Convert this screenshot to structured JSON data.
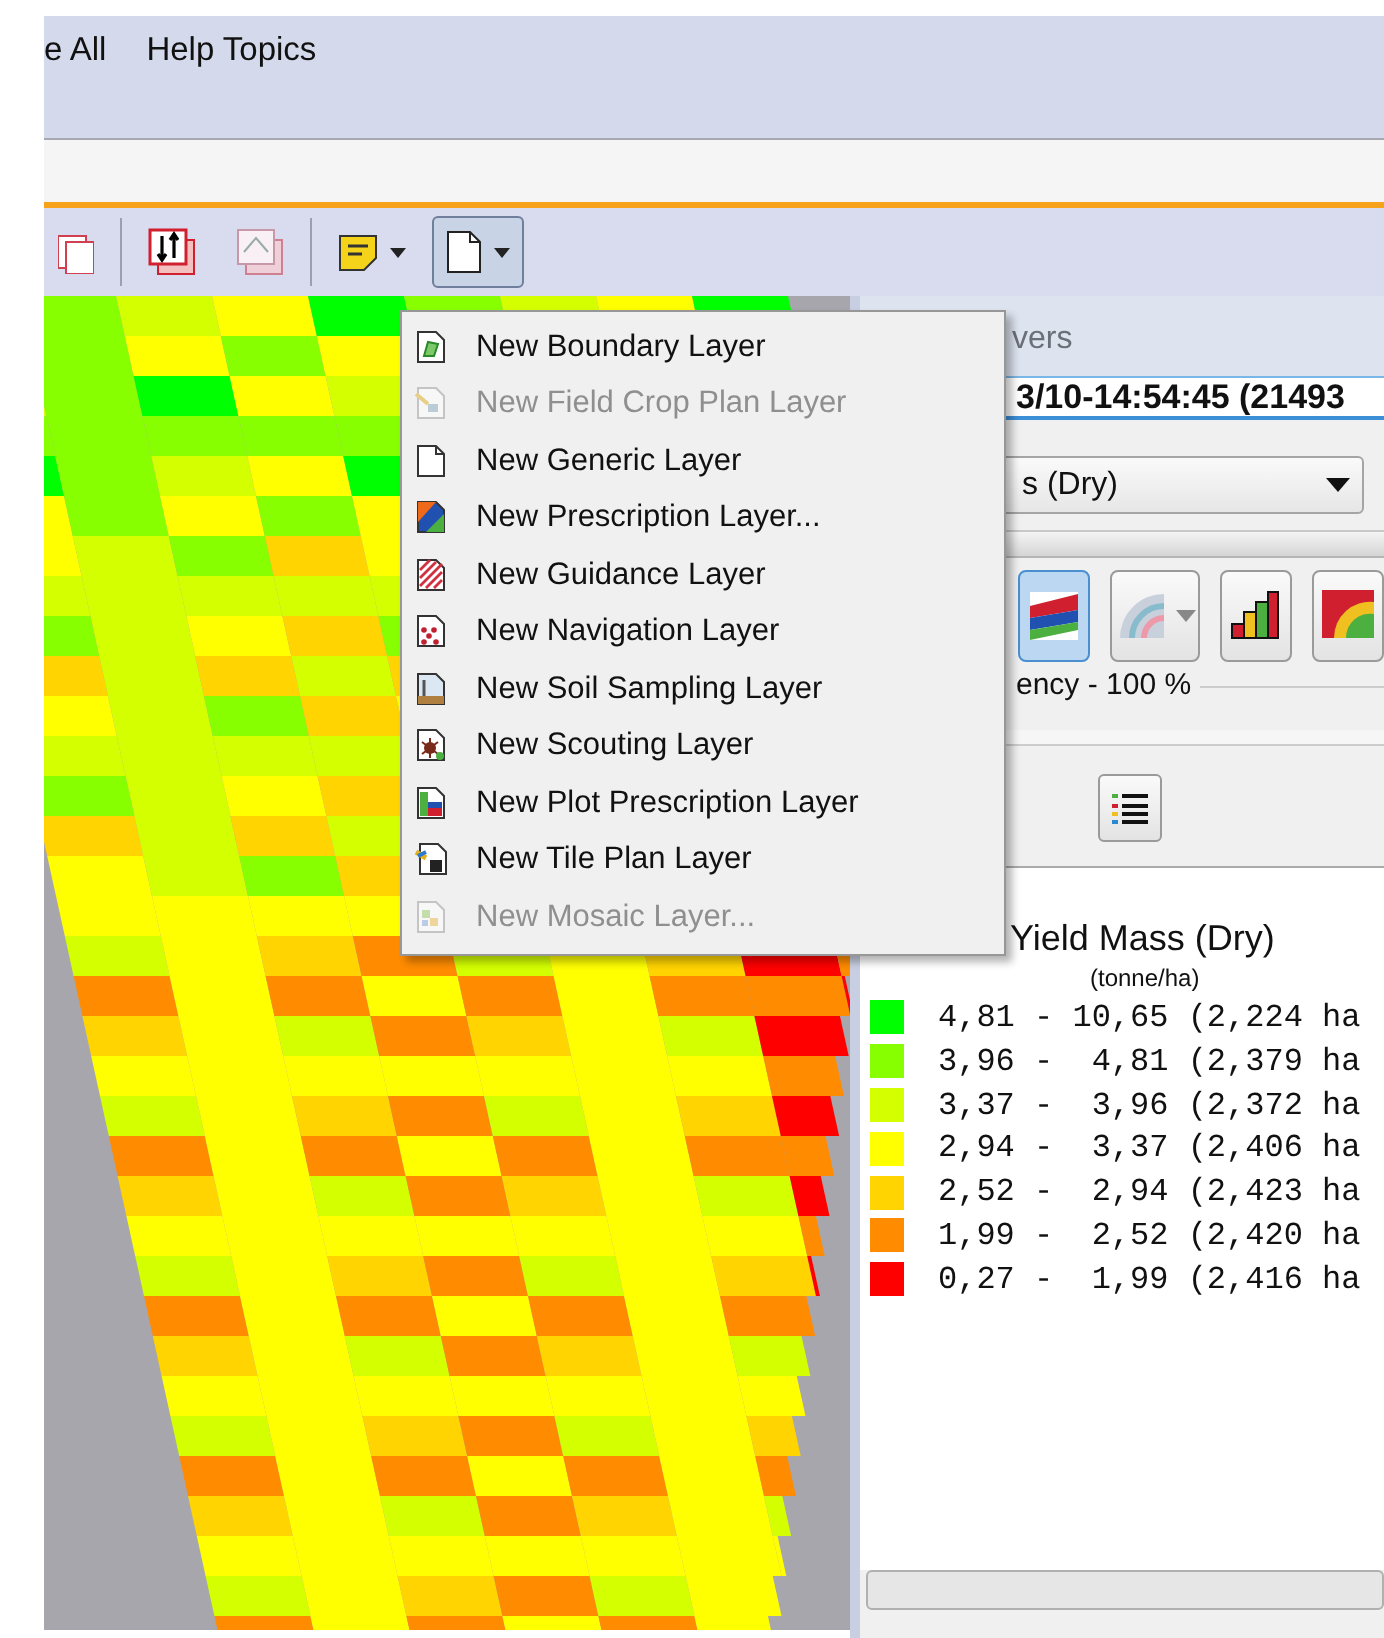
{
  "menu_bar": [
    {
      "label": "e All"
    },
    {
      "label": "Help Topics"
    }
  ],
  "toolbar_buttons": [
    {
      "pressed": false,
      "has_caret": false
    },
    {
      "pressed": false,
      "has_caret": false
    },
    {
      "pressed": false,
      "has_caret": false
    },
    {
      "pressed": false,
      "has_caret": true
    },
    {
      "pressed": true,
      "has_caret": true
    }
  ],
  "new_layer_menu": {
    "items": [
      {
        "label": "New Boundary Layer",
        "disabled": false
      },
      {
        "label": "New Field Crop Plan Layer",
        "disabled": true
      },
      {
        "label": "New Generic Layer",
        "disabled": false
      },
      {
        "label": "New Prescription Layer...",
        "disabled": false
      },
      {
        "label": "New Guidance Layer",
        "disabled": false
      },
      {
        "label": "New Navigation Layer",
        "disabled": false
      },
      {
        "label": "New Soil Sampling Layer",
        "disabled": false
      },
      {
        "label": "New Scouting Layer",
        "disabled": false
      },
      {
        "label": "New Plot Prescription Layer",
        "disabled": false
      },
      {
        "label": "New Tile Plan Layer",
        "disabled": false
      },
      {
        "label": "New Mosaic Layer...",
        "disabled": true
      }
    ]
  },
  "layers_panel": {
    "title": "vers",
    "layer_name": "3/10-14:54:45 (21493",
    "attribute": "s (Dry)",
    "tools": [
      {
        "pressed": true
      },
      {
        "pressed": false
      },
      {
        "pressed": false
      },
      {
        "pressed": false
      }
    ],
    "transparency": "ency - 100 %",
    "legend": {
      "title": "Yield Mass (Dry)",
      "unit": "(tonne/ha)",
      "entries": [
        {
          "color": "#00ff00",
          "text": "4,81 - 10,65 (2,224 ha"
        },
        {
          "color": "#88ff00",
          "text": "3,96 -  4,81 (2,379 ha"
        },
        {
          "color": "#d4ff00",
          "text": "3,37 -  3,96 (2,372 ha"
        },
        {
          "color": "#ffff00",
          "text": "2,94 -  3,37 (2,406 ha"
        },
        {
          "color": "#ffd400",
          "text": "2,52 -  2,94 (2,423 ha"
        },
        {
          "color": "#ff8c00",
          "text": "1,99 -  2,52 (2,420 ha"
        },
        {
          "color": "#ff0000",
          "text": "0,27 -  1,99 (2,416 ha"
        }
      ]
    }
  }
}
